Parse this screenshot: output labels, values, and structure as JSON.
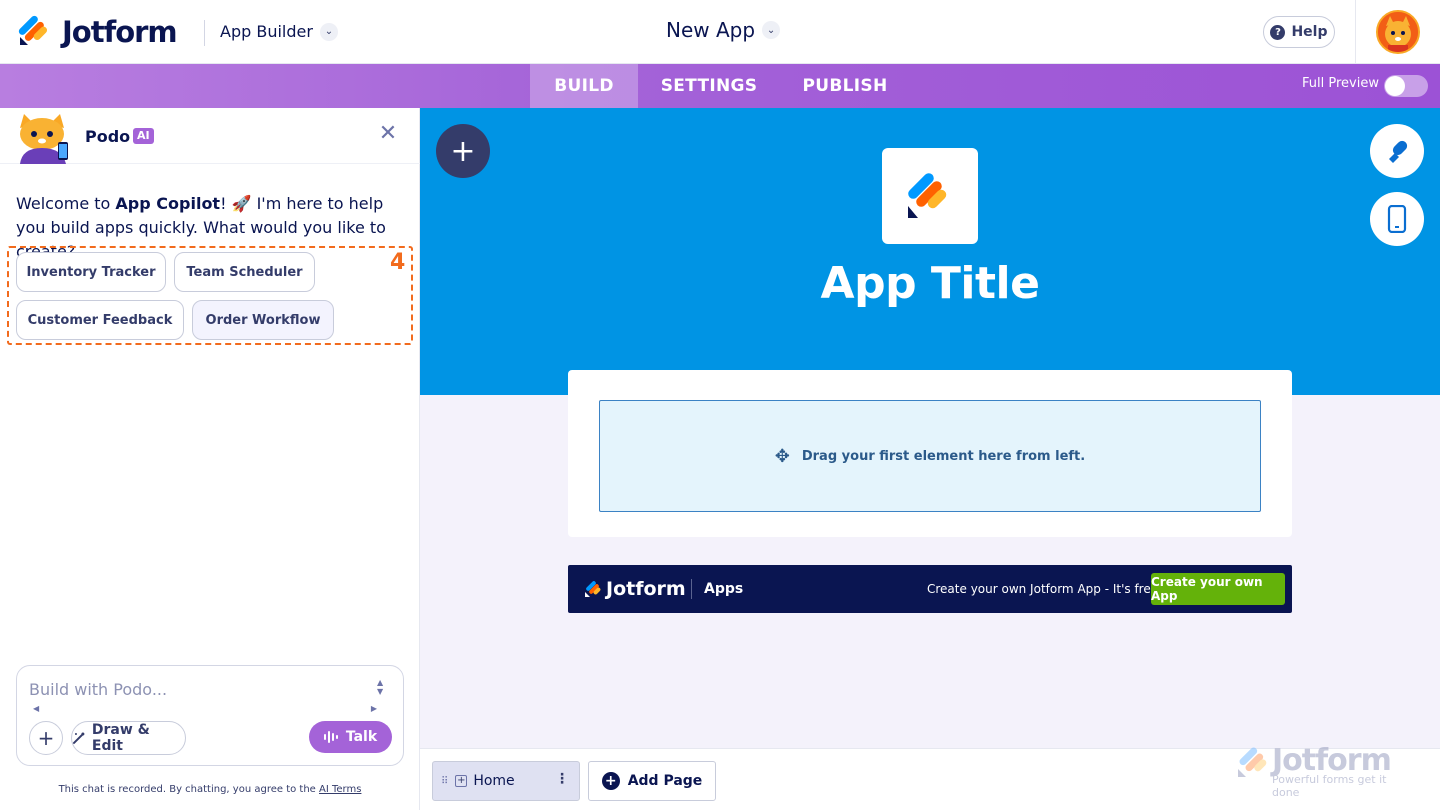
{
  "header": {
    "brand": "Jotform",
    "product": "App Builder",
    "app_name": "New App",
    "help_label": "Help"
  },
  "nav": {
    "tabs": [
      {
        "label": "BUILD",
        "active": true
      },
      {
        "label": "SETTINGS",
        "active": false
      },
      {
        "label": "PUBLISH",
        "active": false
      }
    ],
    "full_preview_label": "Full Preview",
    "full_preview_on": false
  },
  "assistant": {
    "name": "Podo",
    "badge": "AI",
    "welcome_pre": "Welcome to ",
    "welcome_bold": "App Copilot",
    "welcome_post": "! 🚀 I'm here to help you build apps quickly. What would you like to create?",
    "suggestions": [
      "Inventory Tracker",
      "Team Scheduler",
      "Customer Feedback",
      "Order Workflow"
    ],
    "annotation_number": "4",
    "input_placeholder": "Build with Podo...",
    "draw_edit_label": "Draw & Edit",
    "talk_label": "Talk",
    "disclaimer_text": "This chat is recorded. By chatting, you agree to the ",
    "disclaimer_link": "AI Terms"
  },
  "canvas": {
    "app_title": "App Title",
    "dropzone_text": "Drag your first element here from left.",
    "banner_brand": "Jotform",
    "banner_apps": "Apps",
    "banner_text": "Create your own Jotform App - It's free",
    "banner_cta": "Create your own App"
  },
  "pages": {
    "items": [
      "Home"
    ],
    "add_page_label": "Add Page"
  },
  "watermark": {
    "brand": "Jotform",
    "tagline": "Powerful forms get it done"
  },
  "colors": {
    "brand_navy": "#0a1551",
    "nav_purple": "#a463d8",
    "hero_blue": "#0094e4",
    "highlight_orange": "#f26b1d",
    "cta_green": "#64b20a"
  }
}
